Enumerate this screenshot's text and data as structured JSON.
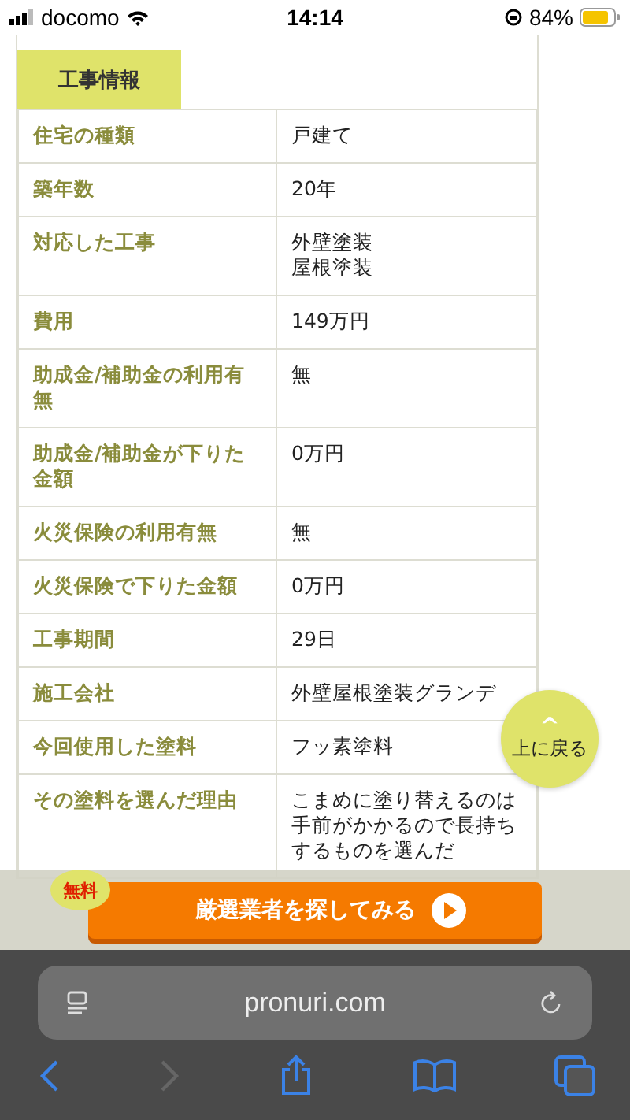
{
  "status_bar": {
    "carrier": "docomo",
    "time": "14:14",
    "battery": "84%"
  },
  "section_tab": "工事情報",
  "rows": [
    {
      "label": "住宅の種類",
      "value": "戸建て"
    },
    {
      "label": "築年数",
      "value": "20年"
    },
    {
      "label": "対応した工事",
      "value": "外壁塗装",
      "value_2": "屋根塗装"
    },
    {
      "label": "費用",
      "value": "149万円"
    },
    {
      "label": "助成金/補助金の利用有無",
      "value": "無"
    },
    {
      "label": "助成金/補助金が下りた金額",
      "value": "0万円"
    },
    {
      "label": "火災保険の利用有無",
      "value": "無"
    },
    {
      "label": "火災保険で下りた金額",
      "value": "0万円"
    },
    {
      "label": "工事期間",
      "value": "29日"
    },
    {
      "label": "施工会社",
      "value": "外壁屋根塗装グランデ"
    },
    {
      "label": "今回使用した塗料",
      "value": "フッ素塗料"
    },
    {
      "label": "その塗料を選んだ理由",
      "value": "こまめに塗り替えるのは手前がかかるので長持ちするものを選んだ"
    }
  ],
  "back_to_top": {
    "arrow": "^",
    "label": "上に戻る"
  },
  "cta": {
    "badge": "無料",
    "label": "厳選業者を探してみる"
  },
  "browser": {
    "url": "pronuri.com",
    "back_disabled": false,
    "forward_disabled": true
  }
}
